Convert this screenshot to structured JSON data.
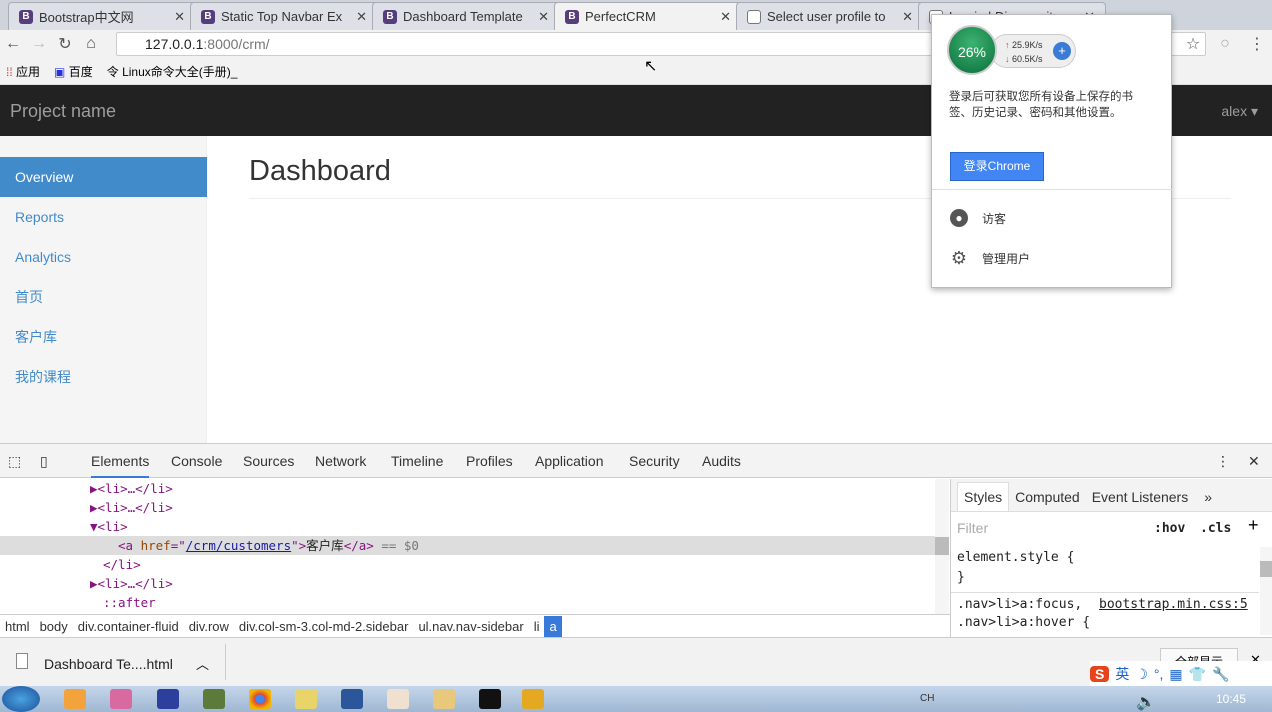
{
  "tabs": [
    {
      "label": "Bootstrap中文网",
      "icon": "bootstrap-icon"
    },
    {
      "label": "Static Top Navbar Ex",
      "icon": "bootstrap-icon"
    },
    {
      "label": "Dashboard Template",
      "icon": "bootstrap-icon"
    },
    {
      "label": "PerfectCRM",
      "icon": "bootstrap-icon",
      "active": true
    },
    {
      "label": "Select user profile to",
      "icon": "document-icon"
    },
    {
      "label": "Log in | Django site",
      "icon": "document-icon"
    }
  ],
  "address": {
    "host": "127.0.0.1",
    "rest": ":8000/crm/"
  },
  "bookmarks": [
    "应用",
    "百度",
    "Linux命令大全(手册)_"
  ],
  "navbar": {
    "brand": "Project name",
    "user": "alex ▾"
  },
  "sidebar": {
    "items": [
      "Overview",
      "Reports",
      "Analytics",
      "首页",
      "客户库",
      "我的课程"
    ],
    "active": 0
  },
  "main": {
    "title": "Dashboard"
  },
  "profile_popup": {
    "message": "登录后可获取您所有设备上保存的书签、历史记录、密码和其他设置。",
    "signin_button": "登录Chrome",
    "menu": [
      "访客",
      "管理用户"
    ],
    "speed_widget": {
      "percent": "26%",
      "up": "25.9K/s",
      "down": "60.5K/s"
    }
  },
  "devtools": {
    "tabs": [
      "Elements",
      "Console",
      "Sources",
      "Network",
      "Timeline",
      "Profiles",
      "Application",
      "Security",
      "Audits"
    ],
    "tree": {
      "li": "<li>…</li>",
      "li_open": "<li>",
      "a_open": "<a ",
      "href_attr": "href",
      "href_val": "/crm/customers",
      "a_text": "客户库",
      "a_close": "</a>",
      "marker": "== $0",
      "li_close": "</li>",
      "after": "::after"
    },
    "breadcrumbs": [
      "html",
      "body",
      "div.container-fluid",
      "div.row",
      "div.col-sm-3.col-md-2.sidebar",
      "ul.nav.nav-sidebar",
      "li",
      "a"
    ],
    "styles": {
      "tabs": [
        "Styles",
        "Computed",
        "Event Listeners",
        "»"
      ],
      "filter_placeholder": "Filter",
      "hov": ":hov",
      "cls": ".cls",
      "rule1": "element.style {",
      "rule1_close": "}",
      "rule2": ".nav>li>a:focus,",
      "rule2_src": "bootstrap.min.css:5",
      "rule3": ".nav>li>a:hover {"
    }
  },
  "download": {
    "file": "Dashboard Te....html",
    "show_all": "全部显示"
  },
  "taskbar": {
    "time": "10:45",
    "lang": "CH",
    "ime": "英"
  }
}
